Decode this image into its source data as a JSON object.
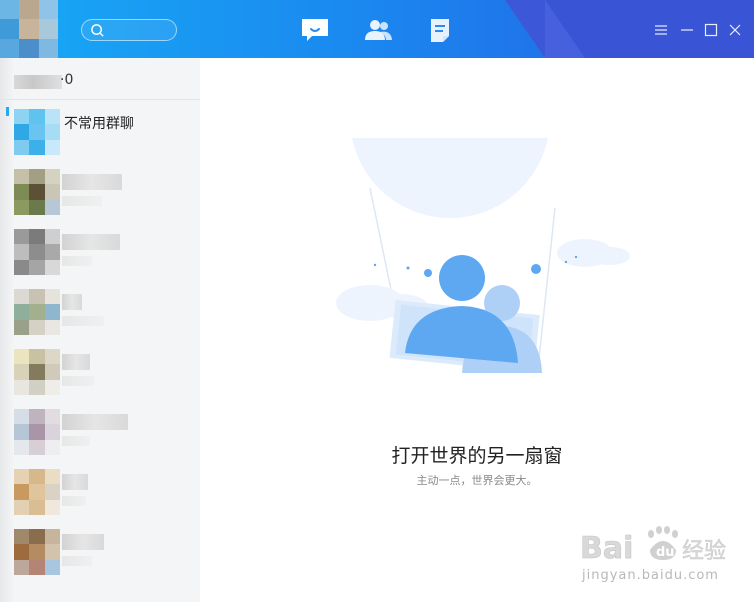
{
  "header": {
    "search": {
      "value": "",
      "placeholder": ""
    },
    "tabs": [
      {
        "name": "messages",
        "icon": "chat-bubble-icon",
        "active": true
      },
      {
        "name": "contacts",
        "icon": "contacts-icon",
        "active": false
      },
      {
        "name": "space",
        "icon": "document-icon",
        "active": false
      }
    ],
    "window_controls": [
      "menu-icon",
      "minimize-icon",
      "maximize-icon",
      "close-icon"
    ]
  },
  "sidebar": {
    "header_count": "·0",
    "items": [
      {
        "name": "不常用群聊"
      }
    ]
  },
  "main": {
    "title": "打开世界的另一扇窗",
    "subtitle": "主动一点，世界会更大。"
  },
  "watermark": {
    "text": "jingyan.baidu.com"
  },
  "colors": {
    "topbar_start": "#18a9f5",
    "topbar_end": "#2b5fe0",
    "accent": "#3b8df5",
    "sidebar_bg": "#f4f5f7"
  }
}
